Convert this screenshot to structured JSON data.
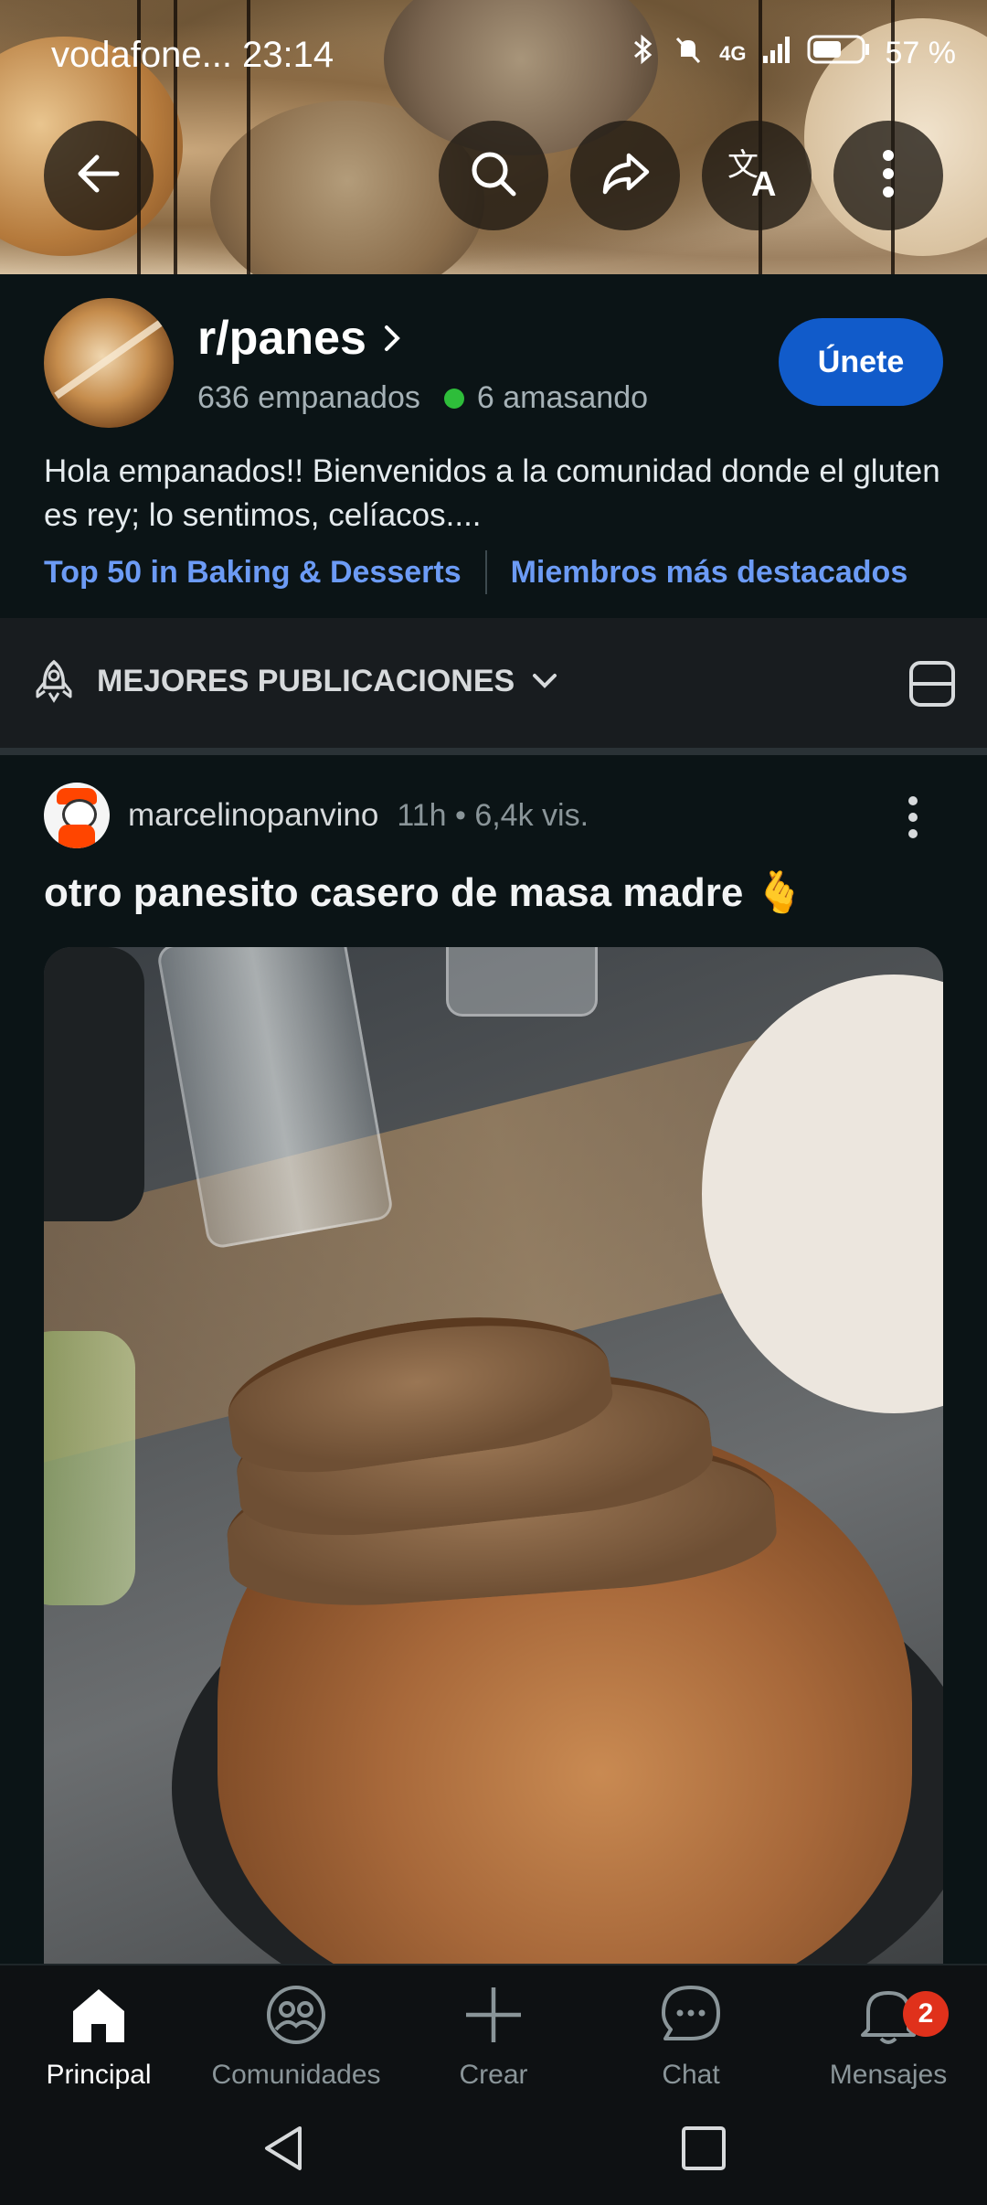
{
  "status_bar": {
    "carrier_time": "vodafone... 23:14",
    "network": "4G",
    "battery": "57 %"
  },
  "community": {
    "name": "r/panes",
    "members": "636 empanados",
    "online": "6 amasando",
    "join_label": "Únete",
    "description": "Hola empanados!! Bienvenidos a la comunidad donde el gluten es rey; lo sentimos, celíacos....",
    "link_ranking": "Top 50 in Baking & Desserts",
    "link_members": "Miembros más destacados"
  },
  "sort": {
    "label": "MEJORES PUBLICACIONES"
  },
  "post": {
    "username": "marcelinopanvino",
    "meta": "11h • 6,4k vis.",
    "title": "otro panesito casero de masa madre 🫰"
  },
  "bottom_nav": {
    "items": [
      {
        "label": "Principal"
      },
      {
        "label": "Comunidades"
      },
      {
        "label": "Crear"
      },
      {
        "label": "Chat"
      },
      {
        "label": "Mensajes"
      }
    ],
    "badge_count": "2"
  },
  "icons": [
    "back-arrow-icon",
    "search-icon",
    "share-icon",
    "translate-icon",
    "more-vertical-icon",
    "chevron-right-icon",
    "chevron-down-icon",
    "layout-card-icon",
    "home-icon",
    "communities-icon",
    "plus-icon",
    "chat-icon",
    "bell-icon"
  ],
  "colors": {
    "background": "#0b1416",
    "join_button": "#115bca",
    "link": "#6c9bf5",
    "online_dot": "#2ebd3a",
    "badge": "#e0311b"
  }
}
